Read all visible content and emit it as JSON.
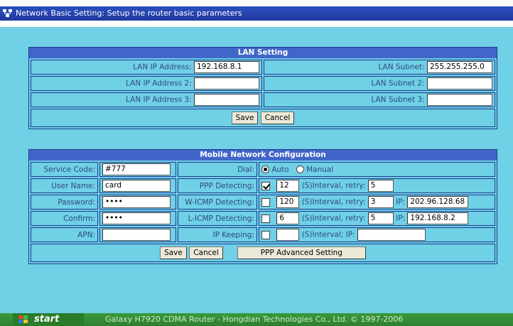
{
  "window": {
    "title": "Network Basic Setting: Setup the router basic parameters"
  },
  "lan": {
    "heading": "LAN Setting",
    "ip1_label": "LAN IP Address:",
    "ip1_value": "192.168.8.1",
    "subnet1_label": "LAN Subnet:",
    "subnet1_value": "255.255.255.0",
    "ip2_label": "LAN IP Address 2:",
    "ip2_value": "",
    "subnet2_label": "LAN Subnet 2:",
    "subnet2_value": "",
    "ip3_label": "LAN IP Address 3:",
    "ip3_value": "",
    "subnet3_label": "LAN Subnet 3:",
    "subnet3_value": "",
    "save_label": "Save",
    "cancel_label": "Cancel"
  },
  "mobile": {
    "heading": "Mobile Network Configuration",
    "service_code_label": "Service Code:",
    "service_code_value": "#777",
    "username_label": "User Name:",
    "username_value": "card",
    "password_label": "Password:",
    "password_value": "••••",
    "confirm_label": "Confirm:",
    "confirm_value": "••••",
    "apn_label": "APN:",
    "apn_value": "",
    "dial_label": "Dial:",
    "dial_auto": "Auto",
    "dial_manual": "Manual",
    "ppp_label": "PPP Detecting:",
    "ppp_interval": "12",
    "ppp_retry": "5",
    "wicmp_label": "W-ICMP Detecting:",
    "wicmp_interval": "120",
    "wicmp_retry": "3",
    "wicmp_ip": "202.96.128.68",
    "licmp_label": "L-ICMP Detecting:",
    "licmp_interval": "6",
    "licmp_retry": "5",
    "licmp_ip": "192.168.8.2",
    "ipkeep_label": "IP Keeping:",
    "ipkeep_interval": "",
    "ipkeep_ip": "",
    "interval_retry_text": "(S)Interval, retry:",
    "ip_text": "IP:",
    "interval_ip_text": "(S)Interval; IP:",
    "save_label": "Save",
    "cancel_label": "Cancel",
    "advanced_label": "PPP Advanced Setting"
  },
  "taskbar": {
    "start_label": "start",
    "status_text": "Galaxy H7920 CDMA Router - Hongdian Technologies Co., Ltd. © 1997-2006"
  },
  "colors": {
    "background": "#6fd0e6",
    "header": "#4166c9",
    "border": "#1f3a8f",
    "taskbar": "#3a9a3a"
  }
}
